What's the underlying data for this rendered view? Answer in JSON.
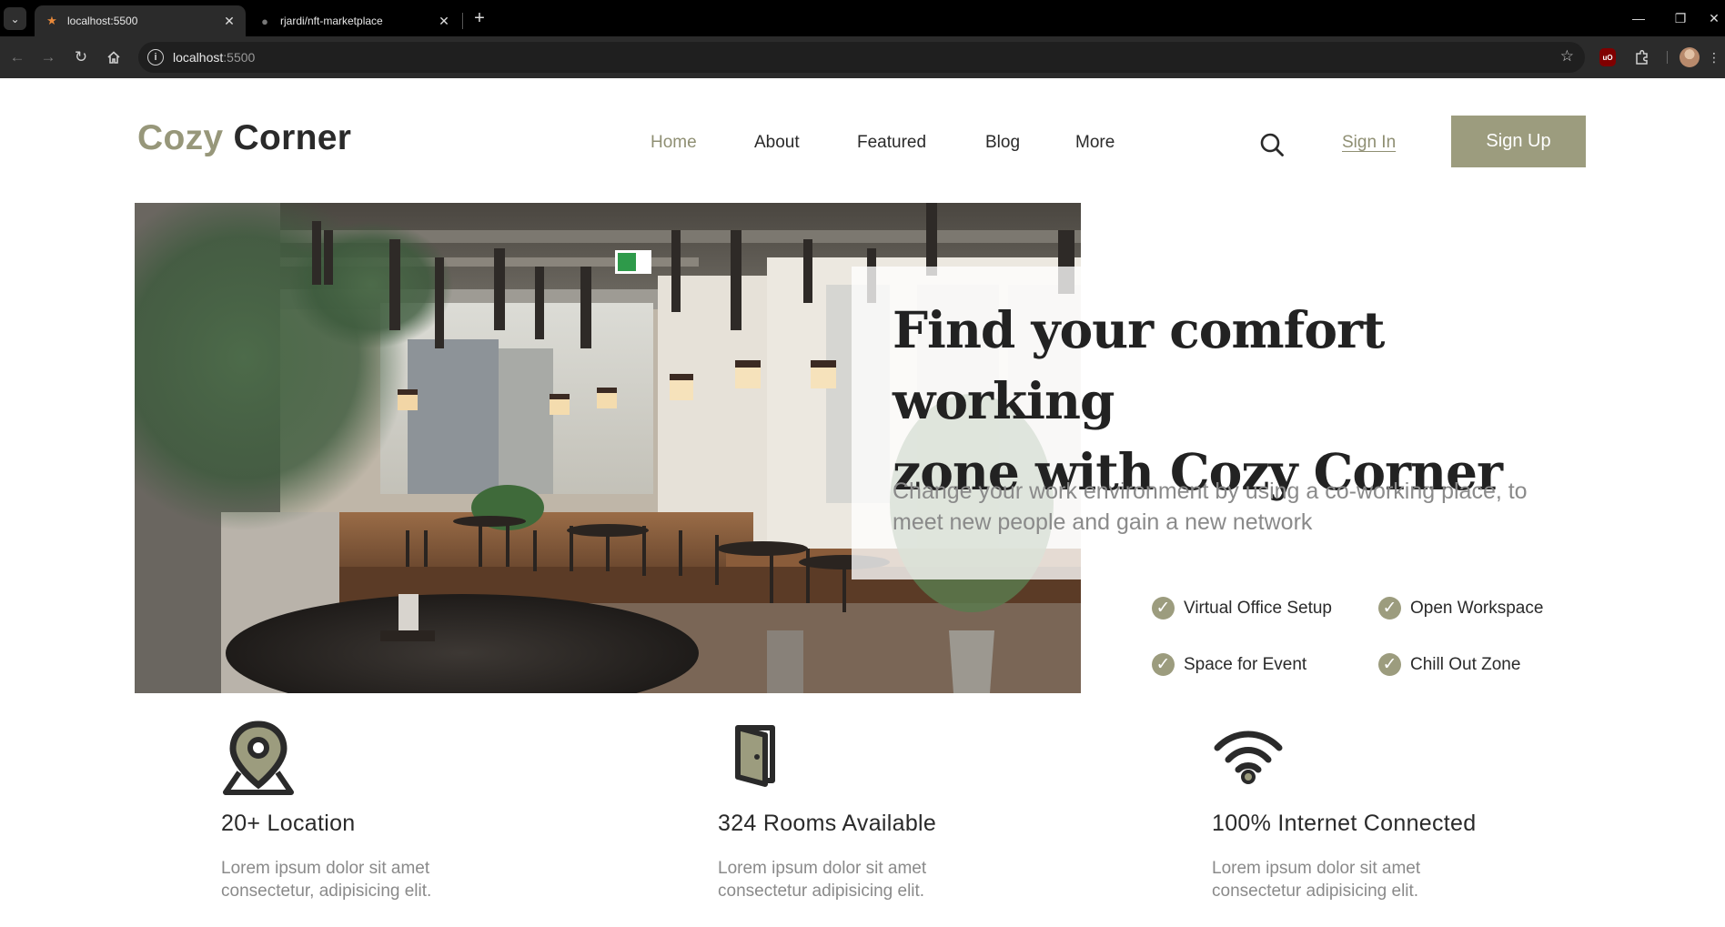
{
  "browser": {
    "tabs": [
      {
        "title": "localhost:5500",
        "favicon": "star-icon",
        "active": true
      },
      {
        "title": "rjardi/nft-marketplace",
        "favicon": "github-icon",
        "active": false
      }
    ],
    "url_host": "localhost",
    "url_port": ":5500",
    "ext_ublock_label": "uO"
  },
  "header": {
    "logo_part1": "Cozy",
    "logo_part2": " Corner",
    "nav": [
      "Home",
      "About",
      "Featured",
      "Blog",
      "More"
    ],
    "active_nav": "Home",
    "signin_label": "Sign In",
    "signup_label": "Sign Up"
  },
  "hero": {
    "title_line1": "Find your comfort working",
    "title_line2": "zone with Cozy Corner",
    "subtitle": "Change your work environment by using a co-working place, to meet new people and gain a new network",
    "features": [
      "Virtual Office Setup",
      "Open Workspace",
      "Space for Event",
      "Chill Out Zone"
    ]
  },
  "stats": [
    {
      "icon": "location-pin-icon",
      "title": "20+ Location",
      "desc": "Lorem ipsum dolor sit amet consectetur, adipisicing elit."
    },
    {
      "icon": "door-icon",
      "title": "324 Rooms Available",
      "desc": "Lorem ipsum dolor sit amet consectetur adipisicing elit."
    },
    {
      "icon": "wifi-icon",
      "title": "100% Internet Connected",
      "desc": "Lorem ipsum dolor sit amet consectetur adipisicing elit."
    }
  ],
  "colors": {
    "accent": "#9c9c7e",
    "accent_text": "#8f8f73",
    "dark_text": "#2a2a2a",
    "muted_text": "#8a8a8a"
  }
}
